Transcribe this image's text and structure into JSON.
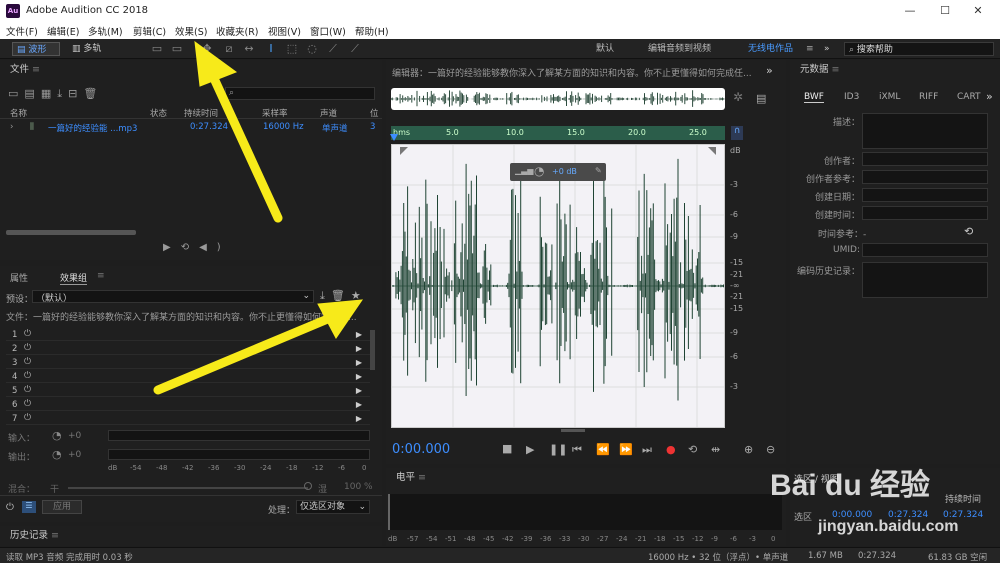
{
  "app": {
    "title": "Adobe Audition CC 2018",
    "logo": "Au"
  },
  "window": {
    "min": "—",
    "max": "☐",
    "close": "✕"
  },
  "menu": [
    "文件(F)",
    "编辑(E)",
    "多轨(M)",
    "剪辑(C)",
    "效果(S)",
    "收藏夹(R)",
    "视图(V)",
    "窗口(W)",
    "帮助(H)"
  ],
  "toolbar": {
    "waveform": "波形",
    "multitrack": "多轨",
    "workspaces": [
      "默认",
      "编辑音频到视频",
      "无线电作品"
    ],
    "search_placeholder": "搜索帮助"
  },
  "files": {
    "title": "文件",
    "columns": [
      "名称",
      "状态",
      "持续时间",
      "采样率",
      "声道",
      "位"
    ],
    "row": {
      "name": "一篇好的经验能 ...mp3",
      "duration": "0:27.324",
      "rate": "16000 Hz",
      "channels": "单声道",
      "bits": "3"
    }
  },
  "effects": {
    "tab1": "属性",
    "tab2": "效果组",
    "preset_label": "预设：",
    "preset_value": "（默认）",
    "file_line": "文件：一篇好的经验能够教你深入了解某方面的知识和内容。你不止更懂得如何完成任...",
    "slots": [
      "1",
      "2",
      "3",
      "4",
      "5",
      "6",
      "7"
    ],
    "input": "输入：",
    "output": "输出：",
    "gain": "+0",
    "meter_scale": [
      "dB",
      "-54",
      "-48",
      "-42",
      "-36",
      "-30",
      "-24",
      "-18",
      "-12",
      "-6",
      "0"
    ],
    "mix": "混合：",
    "dry": "干",
    "wet": "湿",
    "mix_pct": "100 %",
    "apply": "应用",
    "process_label": "处理：",
    "process_value": "仅选区对象"
  },
  "history": {
    "title": "历史记录"
  },
  "editor": {
    "title": "编辑器：一篇好的经验能够教你深入了解某方面的知识和内容。你不止更懂得如何完成任...",
    "ruler": [
      "hms",
      "5.0",
      "10.0",
      "15.0",
      "20.0",
      "25.0"
    ],
    "hud_gain": "+0 dB",
    "db_label": "dB",
    "db_scale": [
      "-3",
      "-6",
      "-9",
      "-15",
      "-21",
      "-∞",
      "-21",
      "-15",
      "-9",
      "-6",
      "-3"
    ],
    "timecode": "0:00.000"
  },
  "levels": {
    "title": "电平",
    "scale": [
      "dB",
      "-57",
      "-54",
      "-51",
      "-48",
      "-45",
      "-42",
      "-39",
      "-36",
      "-33",
      "-30",
      "-27",
      "-24",
      "-21",
      "-18",
      "-15",
      "-12",
      "-9",
      "-6",
      "-3",
      "0"
    ]
  },
  "metadata": {
    "title": "元数据",
    "tabs": [
      "BWF",
      "ID3",
      "iXML",
      "RIFF",
      "CART"
    ],
    "fields": [
      "描述：",
      "创作者：",
      "创作者参考：",
      "创建日期：",
      "创建时间：",
      "时间参考：-",
      "UMID:",
      "编码历史记录："
    ]
  },
  "selection": {
    "title": "选区 / 视图",
    "col_duration": "持续时间",
    "row_label": "选区",
    "start": "0:00.000",
    "end": "0:27.324",
    "dur": "0:27.324"
  },
  "status": {
    "left": "读取 MP3 音频 完成用时 0.03 秒",
    "format": "16000 Hz • 32 位（浮点）• 单声道",
    "size": "1.67 MB",
    "dur": "0:27.324",
    "free": "61.83 GB 空闲"
  },
  "watermark": {
    "brand": "Bai du 经验",
    "url": "jingyan.baidu.com"
  }
}
